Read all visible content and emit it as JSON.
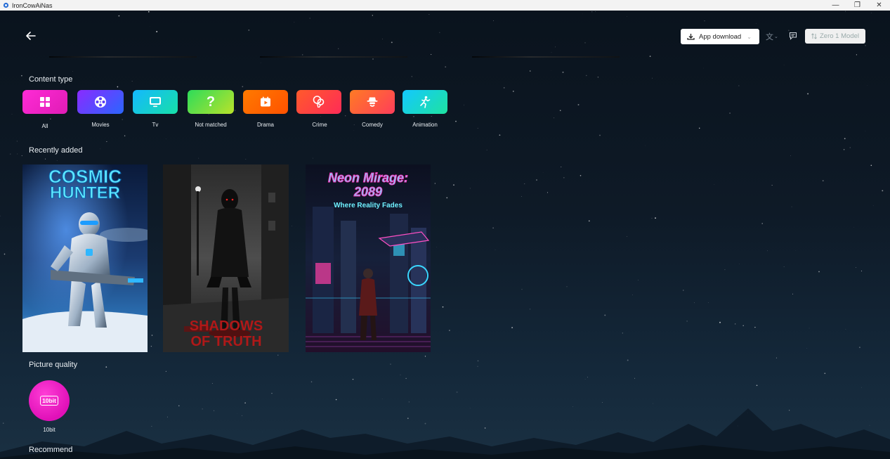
{
  "window": {
    "title": "IronCowAiNas"
  },
  "header": {
    "app_download_label": "App download",
    "model_label": "Zero 1 Model"
  },
  "content_type": {
    "heading": "Content type",
    "items": [
      {
        "label": "All",
        "icon": "grid-icon",
        "color_from": "#ff2bd6",
        "color_to": "#e01cb5"
      },
      {
        "label": "Movies",
        "icon": "film-reel-icon",
        "color_from": "#8a2bff",
        "color_to": "#2a66ff"
      },
      {
        "label": "Tv",
        "icon": "tv-icon",
        "color_from": "#14b8ff",
        "color_to": "#17e0a8"
      },
      {
        "label": "Not matched",
        "icon": "question-icon",
        "color_from": "#2ddc5a",
        "color_to": "#b9e22a"
      },
      {
        "label": "Drama",
        "icon": "play-calendar-icon",
        "color_from": "#ff7a00",
        "color_to": "#ff5200"
      },
      {
        "label": "Crime",
        "icon": "balloons-icon",
        "color_from": "#ff5a2b",
        "color_to": "#ff2b57"
      },
      {
        "label": "Comedy",
        "icon": "hat-face-icon",
        "color_from": "#ff7b24",
        "color_to": "#ff3d5a"
      },
      {
        "label": "Animation",
        "icon": "running-figure-icon",
        "color_from": "#13c8ff",
        "color_to": "#1ee3a0"
      }
    ]
  },
  "recently_added": {
    "heading": "Recently added",
    "posters": [
      {
        "title_line1": "COSMIC",
        "title_line2": "HUNTER"
      },
      {
        "title_line1": "SHADOWS",
        "title_line2": "OF TRUTH"
      },
      {
        "title_line1": "Neon Mirage:",
        "title_line2": "2089",
        "tagline": "Where Reality Fades"
      }
    ]
  },
  "picture_quality": {
    "heading": "Picture quality",
    "items": [
      {
        "badge": "10bit",
        "label": "10bit"
      }
    ]
  },
  "recommend": {
    "heading": "Recommend"
  }
}
